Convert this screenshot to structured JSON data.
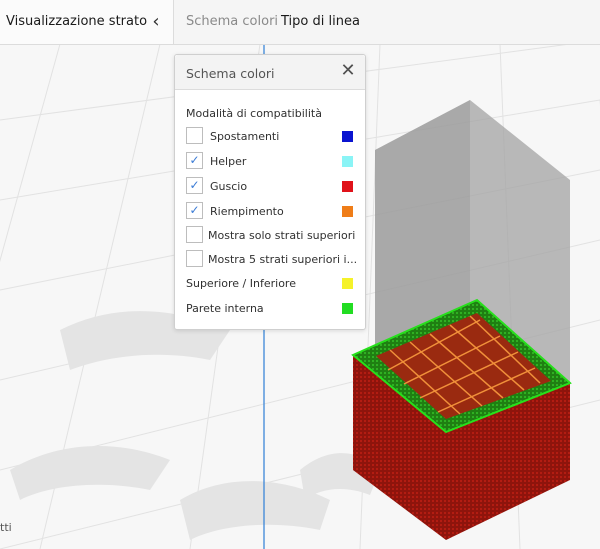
{
  "topbar": {
    "stage_label": "Visualizzazione strato",
    "collapse_glyph": "‹",
    "links": {
      "schema": "Schema colori",
      "tipo": "Tipo di linea"
    }
  },
  "panel": {
    "title": "Schema colori",
    "close_glyph": "✕",
    "section_label": "Modalità di compatibilità",
    "checks": [
      {
        "label": "Spostamenti",
        "checked": false,
        "color": "#0a14d0"
      },
      {
        "label": "Helper",
        "checked": true,
        "color": "#8af4f6"
      },
      {
        "label": "Guscio",
        "checked": true,
        "color": "#e0121a"
      },
      {
        "label": "Riempimento",
        "checked": true,
        "color": "#ef7d18"
      },
      {
        "label": "Mostra solo strati superiori",
        "checked": false
      },
      {
        "label": "Mostra 5 strati superiori i...",
        "checked": false
      }
    ],
    "legend": [
      {
        "label": "Superiore / Inferiore",
        "color": "#f5f22a"
      },
      {
        "label": "Parete interna",
        "color": "#22dd22"
      }
    ]
  },
  "corner_text": "tti",
  "colors": {
    "check": "#3a7bd5",
    "axis": "#2e7fd6",
    "cube_side": "#8e140c",
    "cube_top": "#2f9a1a"
  }
}
